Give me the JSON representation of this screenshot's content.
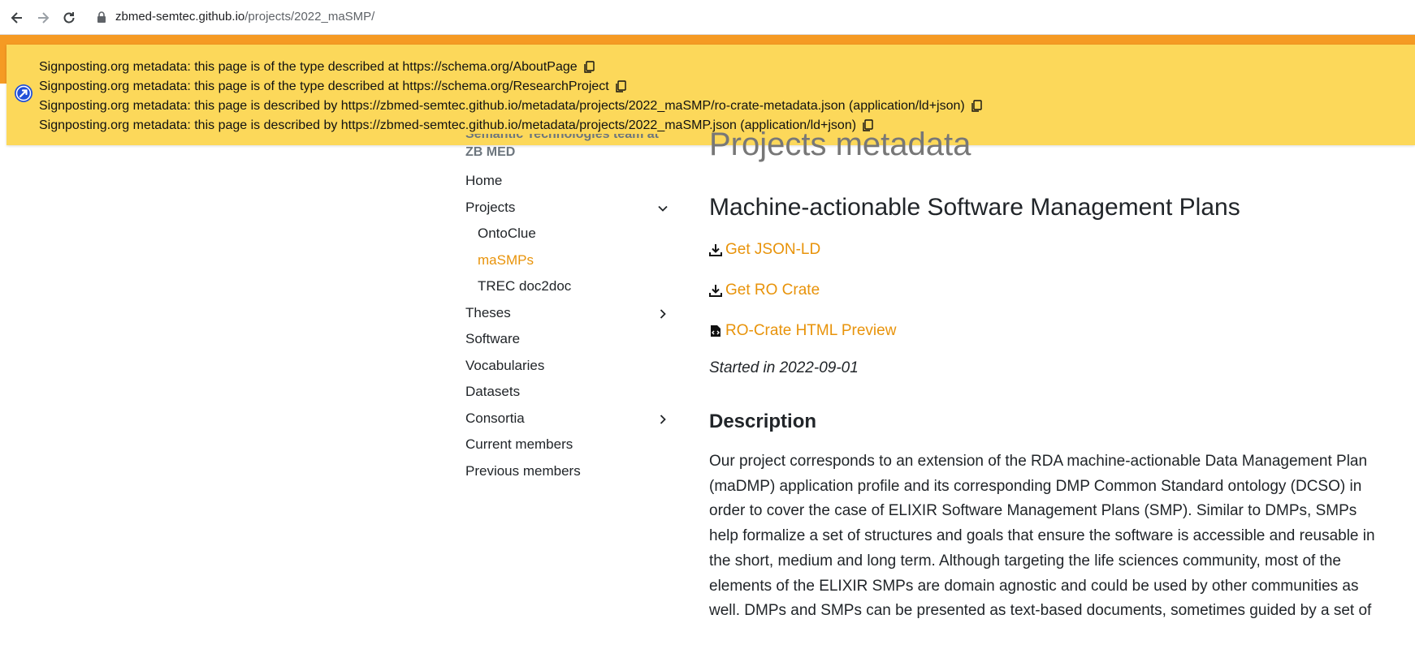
{
  "browser": {
    "url_host": "zbmed-semtec.github.io",
    "url_path": "/projects/2022_maSMP/"
  },
  "notice": {
    "lines": [
      "Signposting.org metadata: this page is of the type described at https://schema.org/AboutPage",
      "Signposting.org metadata: this page is of the type described at https://schema.org/ResearchProject",
      "Signposting.org metadata: this page is described by https://zbmed-semtec.github.io/metadata/projects/2022_maSMP/ro-crate-metadata.json (application/ld+json)",
      "Signposting.org metadata: this page is described by https://zbmed-semtec.github.io/metadata/projects/2022_maSMP.json (application/ld+json)"
    ]
  },
  "sidebar": {
    "site_title_line1": "Semantic Technologies team at",
    "site_title_line2": "ZB MED",
    "items": [
      {
        "label": "Home"
      },
      {
        "label": "Projects"
      },
      {
        "label": "OntoClue"
      },
      {
        "label": "maSMPs"
      },
      {
        "label": "TREC doc2doc"
      },
      {
        "label": "Theses"
      },
      {
        "label": "Software"
      },
      {
        "label": "Vocabularies"
      },
      {
        "label": "Datasets"
      },
      {
        "label": "Consortia"
      },
      {
        "label": "Current members"
      },
      {
        "label": "Previous members"
      }
    ]
  },
  "main": {
    "page_title": "Projects metadata",
    "project_title": "Machine-actionable Software Management Plans",
    "links": {
      "json_ld": "Get JSON-LD",
      "ro_crate": "Get RO Crate",
      "ro_crate_preview": "RO-Crate HTML Preview"
    },
    "started": "Started in 2022-09-01",
    "description_heading": "Description",
    "description": "Our project corresponds to an extension of the RDA machine-actionable Data Management Plan (maDMP) application profile and its corresponding DMP Common Standard ontology (DCSO) in order to cover the case of ELIXIR Software Management Plans (SMP). Similar to DMPs, SMPs help formalize a set of structures and goals that ensure the software is accessible and reusable in the short, medium and long term. Although targeting the life sciences community, most of the elements of the ELIXIR SMPs are domain agnostic and could be used by other communities as well. DMPs and SMPs can be presented as text-based documents, sometimes guided by a set of"
  },
  "colors": {
    "accent": "#e8930a",
    "notice_bg": "#fcd85a",
    "topbar": "#f59a23"
  }
}
